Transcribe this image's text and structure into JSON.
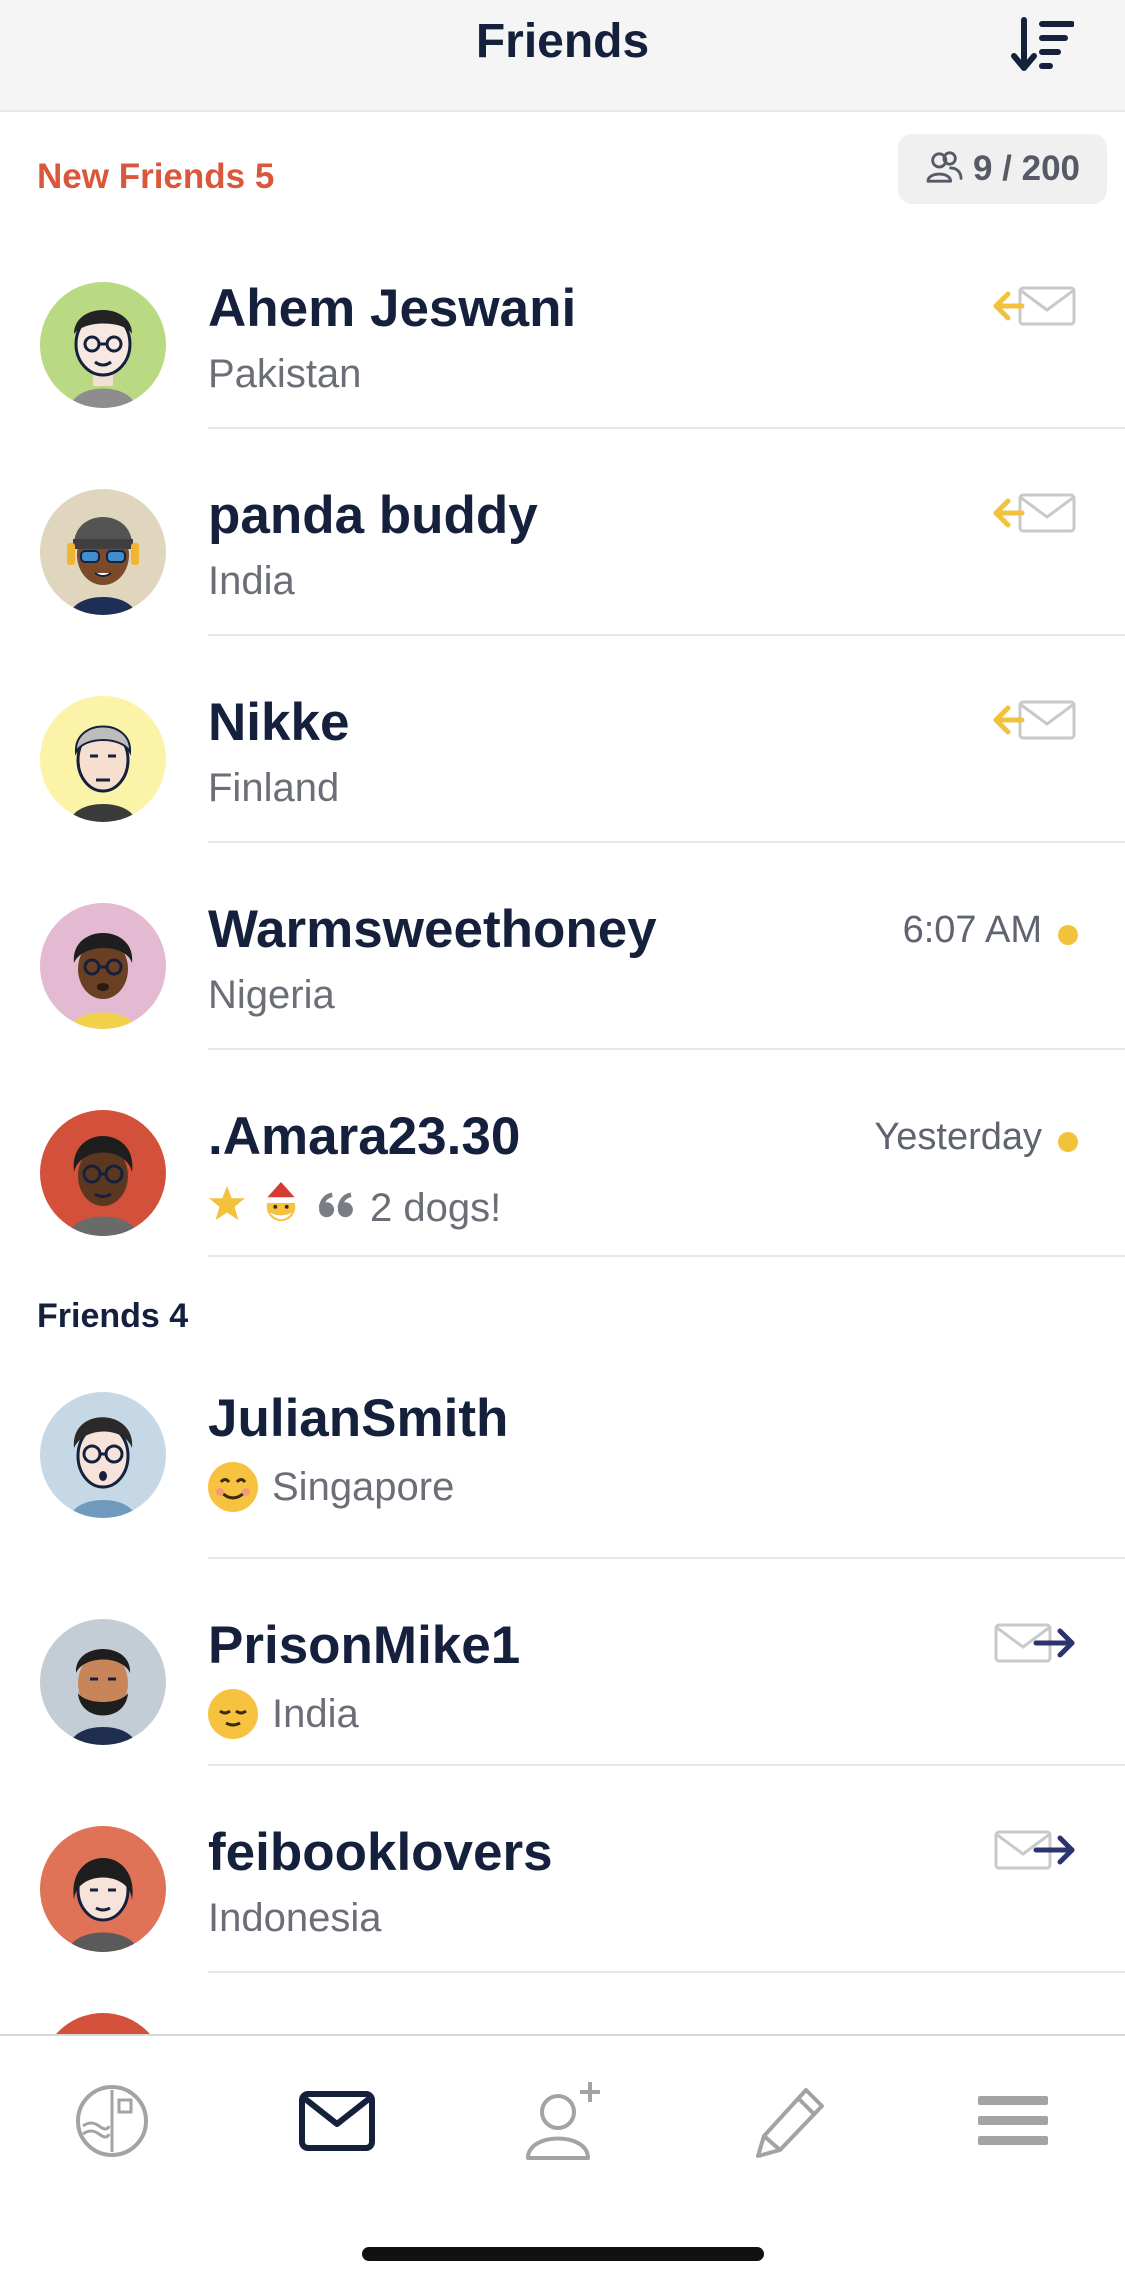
{
  "header": {
    "title": "Friends",
    "sort_icon": "sort-descending-icon"
  },
  "new_friends": {
    "label": "New Friends 5",
    "capacity_icon": "people-icon",
    "capacity": "9 / 200",
    "items": [
      {
        "name": "Ahem Jeswani",
        "subtitle": "Pakistan",
        "status_icon": "incoming-letter-icon"
      },
      {
        "name": "panda buddy",
        "subtitle": "India",
        "status_icon": "incoming-letter-icon"
      },
      {
        "name": "Nikke",
        "subtitle": "Finland",
        "status_icon": "incoming-letter-icon"
      },
      {
        "name": "Warmsweethoney",
        "subtitle": "Nigeria",
        "time": "6:07 AM",
        "unread": true
      },
      {
        "name": ".Amara23.30",
        "subtitle": "2 dogs!",
        "time": "Yesterday",
        "unread": true,
        "badges": [
          "star-icon",
          "santa-emoji-icon",
          "quote-icon"
        ]
      }
    ]
  },
  "friends": {
    "label": "Friends 4",
    "items": [
      {
        "name": "JulianSmith",
        "subtitle": "Singapore",
        "emoji": "smiling-face-icon"
      },
      {
        "name": "PrisonMike1",
        "subtitle": "India",
        "emoji": "relieved-face-icon",
        "status_icon": "outgoing-letter-icon"
      },
      {
        "name": "feibooklovers",
        "subtitle": "Indonesia",
        "status_icon": "outgoing-letter-icon"
      }
    ]
  },
  "tabbar": {
    "items": [
      {
        "name": "stamps",
        "icon": "stamp-icon"
      },
      {
        "name": "letters",
        "icon": "envelope-icon",
        "active": true
      },
      {
        "name": "add-friend",
        "icon": "add-person-icon"
      },
      {
        "name": "write",
        "icon": "pencil-icon"
      },
      {
        "name": "menu",
        "icon": "hamburger-menu-icon"
      }
    ]
  },
  "colors": {
    "accent_new": "#d9573b",
    "text_primary": "#15203d",
    "text_secondary": "#6b6e76",
    "unread_dot": "#f3c23c",
    "incoming_arrow": "#f3c23c",
    "outgoing_arrow": "#2c3470"
  }
}
